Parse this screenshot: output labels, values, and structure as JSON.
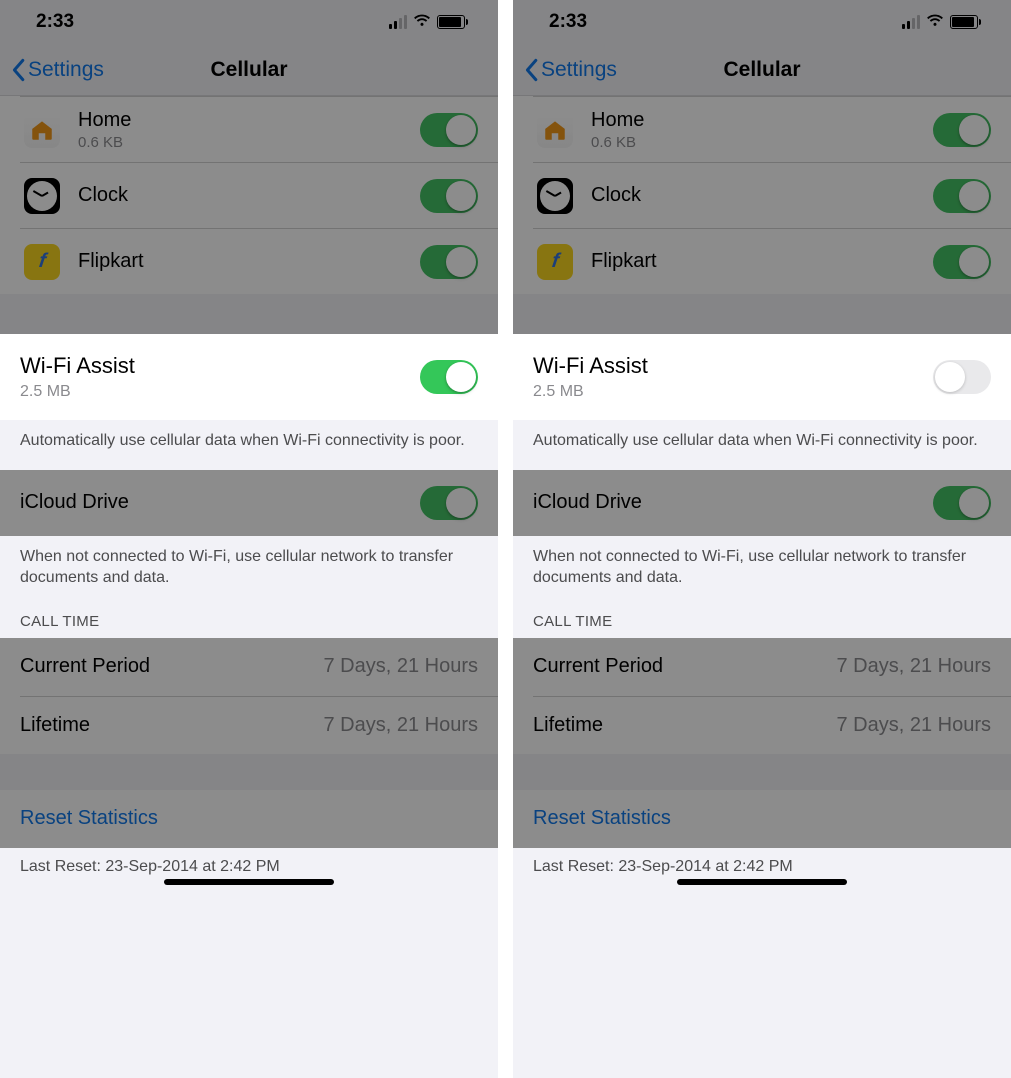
{
  "panes": [
    {
      "status_time": "2:33",
      "nav": {
        "back": "Settings",
        "title": "Cellular"
      },
      "apps": [
        {
          "name": "Home",
          "sub": "0.6 KB",
          "toggle": true
        },
        {
          "name": "Clock",
          "toggle": true
        },
        {
          "name": "Flipkart",
          "toggle": true
        }
      ],
      "wifi_assist": {
        "title": "Wi-Fi Assist",
        "sub": "2.5 MB",
        "toggle": true
      },
      "wifi_assist_desc": "Automatically use cellular data when Wi-Fi connectivity is poor.",
      "icloud": {
        "title": "iCloud Drive",
        "toggle": true
      },
      "icloud_desc": "When not connected to Wi-Fi, use cellular network to transfer documents and data.",
      "call_time_header": "CALL TIME",
      "current_period": {
        "label": "Current Period",
        "value": "7 Days, 21 Hours"
      },
      "lifetime": {
        "label": "Lifetime",
        "value": "7 Days, 21 Hours"
      },
      "reset": "Reset Statistics",
      "last_reset": "Last Reset: 23-Sep-2014 at 2:42 PM"
    },
    {
      "status_time": "2:33",
      "nav": {
        "back": "Settings",
        "title": "Cellular"
      },
      "apps": [
        {
          "name": "Home",
          "sub": "0.6 KB",
          "toggle": true
        },
        {
          "name": "Clock",
          "toggle": true
        },
        {
          "name": "Flipkart",
          "toggle": true
        }
      ],
      "wifi_assist": {
        "title": "Wi-Fi Assist",
        "sub": "2.5 MB",
        "toggle": false
      },
      "wifi_assist_desc": "Automatically use cellular data when Wi-Fi connectivity is poor.",
      "icloud": {
        "title": "iCloud Drive",
        "toggle": true
      },
      "icloud_desc": "When not connected to Wi-Fi, use cellular network to transfer documents and data.",
      "call_time_header": "CALL TIME",
      "current_period": {
        "label": "Current Period",
        "value": "7 Days, 21 Hours"
      },
      "lifetime": {
        "label": "Lifetime",
        "value": "7 Days, 21 Hours"
      },
      "reset": "Reset Statistics",
      "last_reset": "Last Reset: 23-Sep-2014 at 2:42 PM"
    }
  ]
}
